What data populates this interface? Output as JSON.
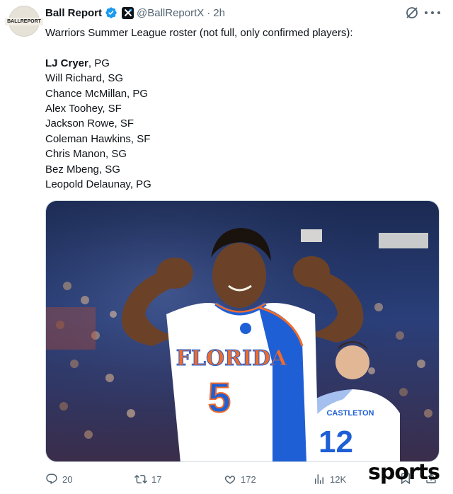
{
  "author": {
    "display_name": "Ball Report",
    "avatar_label": "BALLREPORT",
    "handle": "@BallReportX",
    "separator": "·",
    "time": "2h"
  },
  "tweet": {
    "intro": "Warriors Summer League roster (not full, only confirmed players):",
    "roster": [
      {
        "name": "LJ Cryer",
        "pos": ", PG"
      },
      {
        "name": "Will Richard",
        "pos": ", SG"
      },
      {
        "name": "Chance McMillan",
        "pos": ", PG"
      },
      {
        "name": "Alex Toohey",
        "pos": ", SF"
      },
      {
        "name": "Jackson Rowe",
        "pos": ", SF"
      },
      {
        "name": "Coleman Hawkins",
        "pos": ", SF"
      },
      {
        "name": "Chris Manon",
        "pos": ", SG"
      },
      {
        "name": "Bez Mbeng",
        "pos": ", SG"
      },
      {
        "name": "Leopold Delaunay",
        "pos": ", PG"
      }
    ]
  },
  "media": {
    "jersey_text": "FLORIDA",
    "jersey_number": "5",
    "back_jersey_text": "CASTLETON",
    "back_jersey_number": "12"
  },
  "actions": {
    "replies": "20",
    "reposts": "17",
    "likes": "172",
    "views": "12K"
  },
  "watermark": "sports",
  "colors": {
    "text": "#0f1419",
    "secondary": "#536471",
    "verified": "#1d9bf0",
    "jersey_blue": "#1f5fd6",
    "jersey_orange": "#f06b2a"
  }
}
